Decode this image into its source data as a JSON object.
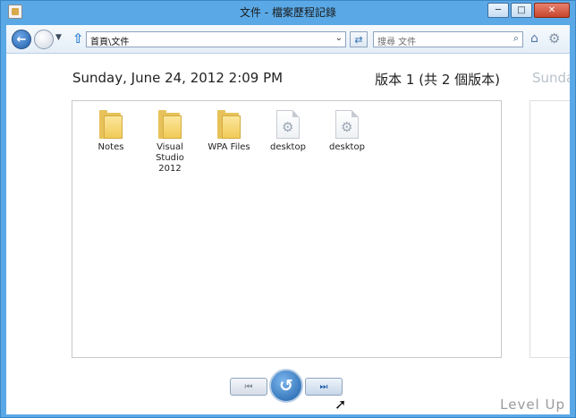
{
  "window": {
    "title": "文件 - 檔案歷程記錄",
    "minimize_glyph": "─",
    "maximize_glyph": "□",
    "close_glyph": "✕"
  },
  "toolbar": {
    "back_glyph": "←",
    "up_glyph": "⇧",
    "address": "首頁\\文件",
    "address_dropdown_glyph": "⌄",
    "refresh_glyph": "⇄",
    "search_placeholder": "搜尋 文件",
    "search_icon": "⌕",
    "home_icon": "⌂",
    "gear_icon": "⚙"
  },
  "version": {
    "date": "Sunday, June 24, 2012 2:09 PM",
    "label": "版本 1 (共 2 個版本)",
    "next_date_peek": "Sunday"
  },
  "files": [
    {
      "name": "Notes",
      "type": "folder"
    },
    {
      "name": "Visual Studio 2012",
      "type": "folder"
    },
    {
      "name": "WPA Files",
      "type": "folder"
    },
    {
      "name": "desktop",
      "type": "document"
    },
    {
      "name": "desktop",
      "type": "document"
    }
  ],
  "controls": {
    "previous_glyph": "⏮",
    "restore_glyph": "↺",
    "next_glyph": "⏭"
  },
  "watermark": "Level Up"
}
